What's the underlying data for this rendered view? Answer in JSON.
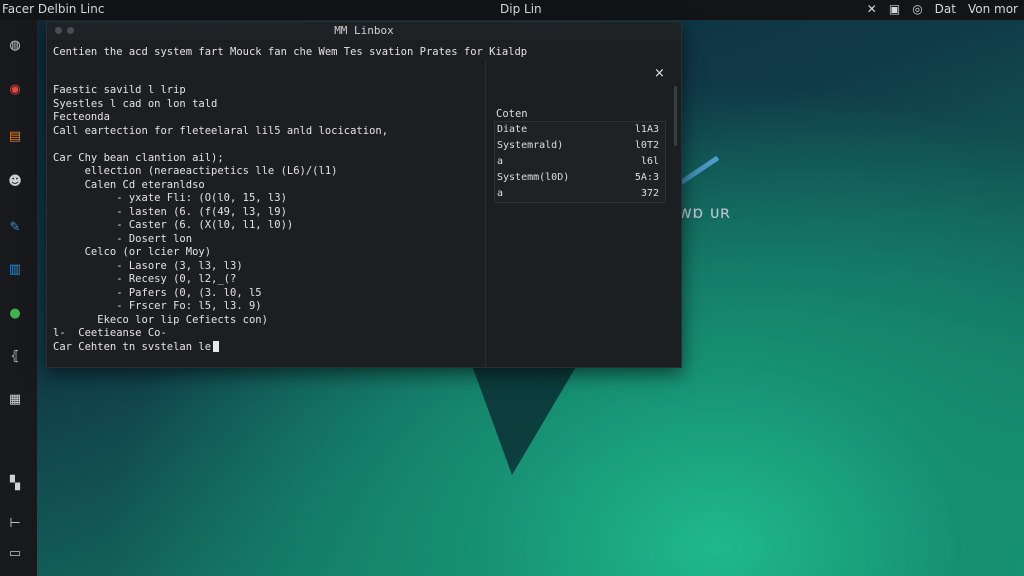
{
  "topbar": {
    "app_title": "Facer Delbin Linc",
    "clock": "Dip Lin",
    "tray": {
      "icon1": "✕",
      "icon2": "▣",
      "icon3": "◎",
      "label1": "Dat",
      "label2": "Von mor"
    }
  },
  "dock": {
    "items": [
      {
        "name": "installer-icon",
        "glyph": "◍",
        "color": "#cfcfcf"
      },
      {
        "name": "chrome-icon",
        "glyph": "◉",
        "color": "#e8453c"
      },
      {
        "name": "files-icon",
        "glyph": "▤",
        "color": "#e07a22"
      },
      {
        "name": "users-icon",
        "glyph": "☻",
        "color": "#cfcfcf"
      },
      {
        "name": "pen-icon",
        "glyph": "✎",
        "color": "#3d8fe0"
      },
      {
        "name": "store-icon",
        "glyph": "▥",
        "color": "#2e8fd8"
      },
      {
        "name": "green-app-icon",
        "glyph": "●",
        "color": "#3fb24a"
      },
      {
        "name": "brackets-icon",
        "glyph": "⦃",
        "color": "#cfcfcf"
      },
      {
        "name": "grid-icon",
        "glyph": "▦",
        "color": "#d0d0d0"
      },
      {
        "name": "puzzle-icon",
        "glyph": "▚",
        "color": "#d0d0d0"
      },
      {
        "name": "slider-icon",
        "glyph": "⊢",
        "color": "#d0d0d0"
      },
      {
        "name": "trash-icon",
        "glyph": "▭",
        "color": "#bfbfbf"
      }
    ]
  },
  "desktop": {
    "logo_text": "wɒ ᴜʀ"
  },
  "window": {
    "title": "MM Linbox",
    "header_line": "Centien the acd system fart Mouck fan che Wem Tes svation Prates for Kialdp",
    "lines": [
      "Faestic savild l lrip",
      "Syestles l cad on lon tald",
      "Fecteonda",
      "Call eartection for fleteelaral lil5 anld locication,",
      "",
      "Car Chy bean clantion ail);",
      "     ellection (neraeactipetics lle (L6)/(l1)",
      "     Calen Cd eteranldso",
      "          - yxate Fli: (O(l0, 15, l3)",
      "          - lasten (6. (f(49, l3, l9)",
      "          - Caster (6. (X(l0, l1, l0))",
      "          - Dosert lon",
      "     Celco (or lcier Moy)",
      "          - Lasore (3, l3, l3)",
      "          - Recesy (0, l2,_(?",
      "          - Pafers (0, (3. l0, l5",
      "          - Frscer Fo: l5, l3. 9)",
      "       Ekeco lor lip Cefiects con)",
      "l-  Ceetieanse Co-",
      "Car Cehten tn svstelan le"
    ],
    "side": {
      "close_label": "×",
      "header": "Coten",
      "rows": [
        {
          "k": "Diate",
          "v": "l1A3"
        },
        {
          "k": "Systemrald)",
          "v": "l0T2"
        },
        {
          "k": "a",
          "v": "l6l"
        },
        {
          "k": "Systemm(l0D)",
          "v": "5A:3"
        },
        {
          "k": "a",
          "v": "372"
        }
      ]
    }
  }
}
